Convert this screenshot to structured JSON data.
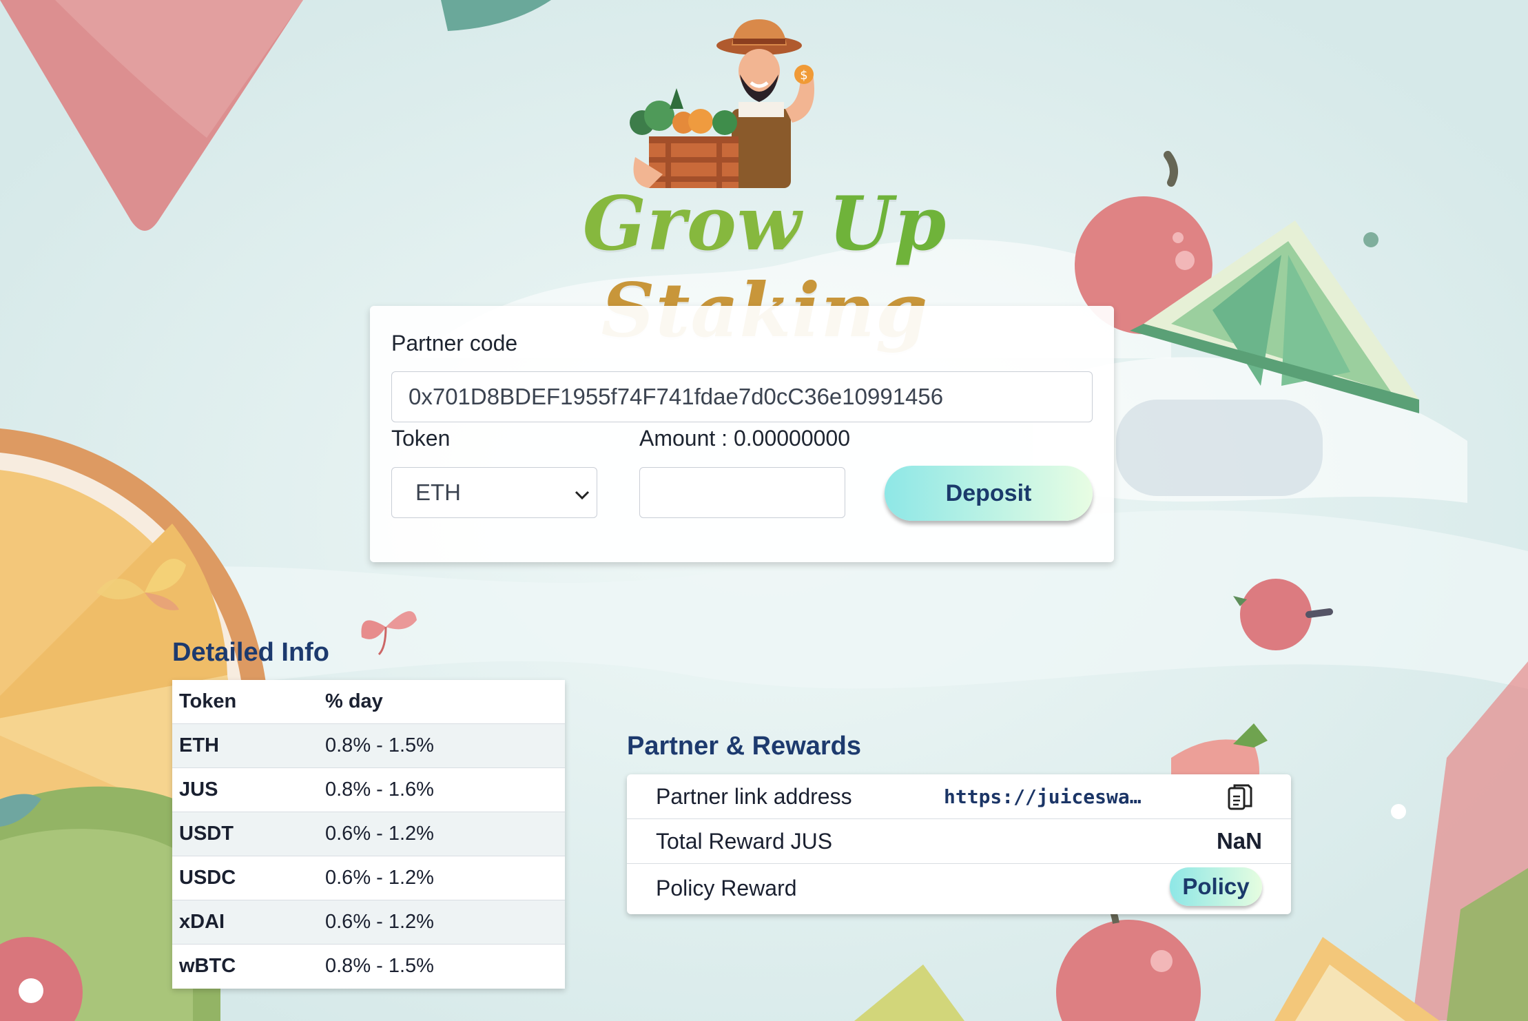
{
  "app": {
    "title": "Grow Up Staking",
    "title_parts": [
      "Grow",
      "Up",
      "Staking"
    ]
  },
  "deposit_form": {
    "partner_code_label": "Partner code",
    "partner_code_value": "0x701D8BDEF1955f74F741fdae7d0cC36e10991456",
    "token_label": "Token",
    "token_selected": "ETH",
    "amount_label": "Amount : 0.00000000",
    "amount_value": "",
    "deposit_button": "Deposit"
  },
  "detailed_info": {
    "title": "Detailed Info",
    "headers": [
      "Token",
      "% day"
    ],
    "rows": [
      {
        "token": "ETH",
        "rate": "0.8% - 1.5%"
      },
      {
        "token": "JUS",
        "rate": "0.8% - 1.6%"
      },
      {
        "token": "USDT",
        "rate": "0.6% - 1.2%"
      },
      {
        "token": "USDC",
        "rate": "0.6% - 1.2%"
      },
      {
        "token": "xDAI",
        "rate": "0.6% - 1.2%"
      },
      {
        "token": "wBTC",
        "rate": "0.8% - 1.5%"
      }
    ]
  },
  "partner_rewards": {
    "title": "Partner & Rewards",
    "partner_link_label": "Partner link address",
    "partner_link_value": "https://juiceswap.fina…",
    "total_reward_label": "Total Reward JUS",
    "total_reward_value": "NaN",
    "policy_reward_label": "Policy Reward",
    "policy_button": "Policy"
  },
  "icons": {
    "copy": "copy-icon",
    "select_arrow": "chevron-down-icon"
  },
  "colors": {
    "background": "#dfeeee",
    "button_gradient_start": "#8ee7e6",
    "button_gradient_end": "#e8fde3",
    "heading_blue": "#1d3a6e"
  }
}
